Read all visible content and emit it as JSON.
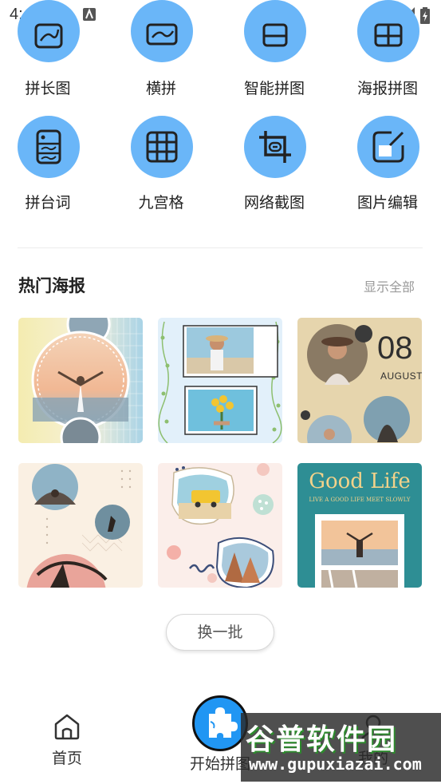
{
  "status_bar": {
    "time": "4:43",
    "icons": [
      "download-icon",
      "notification-a-icon",
      "wifi-icon",
      "signal-icon",
      "battery-icon"
    ]
  },
  "tools": [
    {
      "label": "拼长图",
      "icon": "long-stitch-icon"
    },
    {
      "label": "横拼",
      "icon": "horizontal-stitch-icon"
    },
    {
      "label": "智能拼图",
      "icon": "smart-collage-icon"
    },
    {
      "label": "海报拼图",
      "icon": "poster-collage-icon"
    },
    {
      "label": "拼台词",
      "icon": "subtitle-stitch-icon"
    },
    {
      "label": "九宫格",
      "icon": "nine-grid-icon"
    },
    {
      "label": "网络截图",
      "icon": "web-screenshot-icon"
    },
    {
      "label": "图片编辑",
      "icon": "image-edit-icon"
    }
  ],
  "hot_posters": {
    "title": "热门海报",
    "show_all": "显示全部",
    "poster3": {
      "day": "08",
      "month": "AUGUST"
    },
    "poster6": {
      "title": "Good Life",
      "subtitle": "LIVE A GOOD LIFE MEET SLOWLY"
    },
    "refresh_label": "换一批"
  },
  "bottom_nav": {
    "home": "首页",
    "start": "开始拼图",
    "mine": "我的"
  },
  "watermark": {
    "main": "谷普软件园",
    "url": "www.gupuxiazai.com"
  },
  "colors": {
    "accent": "#6ab6f8",
    "fab": "#2196f3",
    "poster_teal": "#2e8e94"
  }
}
